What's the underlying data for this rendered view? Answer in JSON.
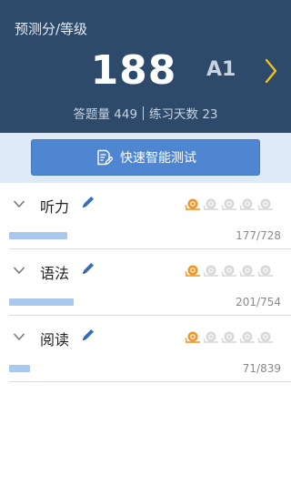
{
  "header": {
    "title": "预测分/等级",
    "score": "188",
    "grade": "A1",
    "answered": "答题量 449",
    "practice_days": "练习天数 23"
  },
  "quick_test": {
    "label": "快速智能测试"
  },
  "sections": [
    {
      "title": "听力",
      "progress": "177/728",
      "fraction": 0.243,
      "level": 1,
      "total_levels": 5
    },
    {
      "title": "语法",
      "progress": "201/754",
      "fraction": 0.267,
      "level": 1,
      "total_levels": 5
    },
    {
      "title": "阅读",
      "progress": "71/839",
      "fraction": 0.085,
      "level": 1,
      "total_levels": 5
    }
  ],
  "colors": {
    "header_bg": "#2d4a6b",
    "accent_button": "#4f86d1",
    "progress_bar": "#a9c8f0",
    "chevron_yellow": "#f2c21b",
    "snail_active": "#f0962a",
    "snail_inactive": "#d8d8d8"
  },
  "icons": [
    "chevron-right-icon",
    "edit-note-icon",
    "chevron-down-icon",
    "pencil-icon",
    "snail-icon"
  ]
}
